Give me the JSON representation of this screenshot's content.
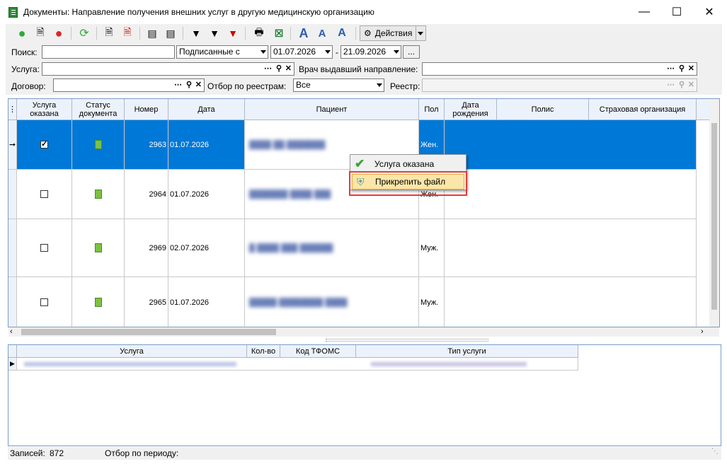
{
  "window": {
    "title": "Документы: Направление получения внешних услуг в другую медицинскую организацию"
  },
  "toolbar": {
    "actions_label": "Действия"
  },
  "filters": {
    "search_label": "Поиск:",
    "search_value": "",
    "signed_select": "Подписанные с",
    "date_from": "01.07.2026",
    "date_sep": "-",
    "date_to": "21.09.2026",
    "more": "...",
    "service_label": "Услуга:",
    "service_value": "",
    "doctor_label": "Врач выдавший направление:",
    "doctor_value": "",
    "contract_label": "Договор:",
    "contract_value": "",
    "registry_filter_label": "Отбор по реестрам:",
    "registry_filter_value": "Все",
    "registry_label": "Реестр:",
    "registry_value": ""
  },
  "grid": {
    "headers": [
      "Услуга оказана",
      "Статус документа",
      "Номер",
      "Дата",
      "Пациент",
      "Пол",
      "Дата рождения",
      "Полис",
      "Страховая организация"
    ],
    "rows": [
      {
        "done": true,
        "number": "2963",
        "date": "01.07.2026",
        "patient": "████ ██ ███████",
        "sex": "Жен.",
        "selected": true
      },
      {
        "done": false,
        "number": "2964",
        "date": "01.07.2026",
        "patient": "███████ ████ ███",
        "sex": "Жен.",
        "selected": false
      },
      {
        "done": false,
        "number": "2969",
        "date": "02.07.2026",
        "patient": "█ ████ ███ ██████",
        "sex": "Муж.",
        "selected": false
      },
      {
        "done": false,
        "number": "2965",
        "date": "01.07.2026",
        "patient": "█████ ████████ ████",
        "sex": "Муж.",
        "selected": false
      }
    ]
  },
  "context_menu": {
    "items": [
      "Услуга оказана",
      "Прикрепить файл"
    ],
    "highlighted_index": 1
  },
  "lower_grid": {
    "headers": [
      "Услуга",
      "Кол-во",
      "Код ТФОМС",
      "Тип услуги"
    ]
  },
  "status": {
    "records_label": "Записей:",
    "records_value": "872",
    "period_label": "Отбор по периоду:"
  },
  "colors": {
    "selection": "#0078d7",
    "highlight": "#e63b3b",
    "doc_status": "#7cc142"
  }
}
